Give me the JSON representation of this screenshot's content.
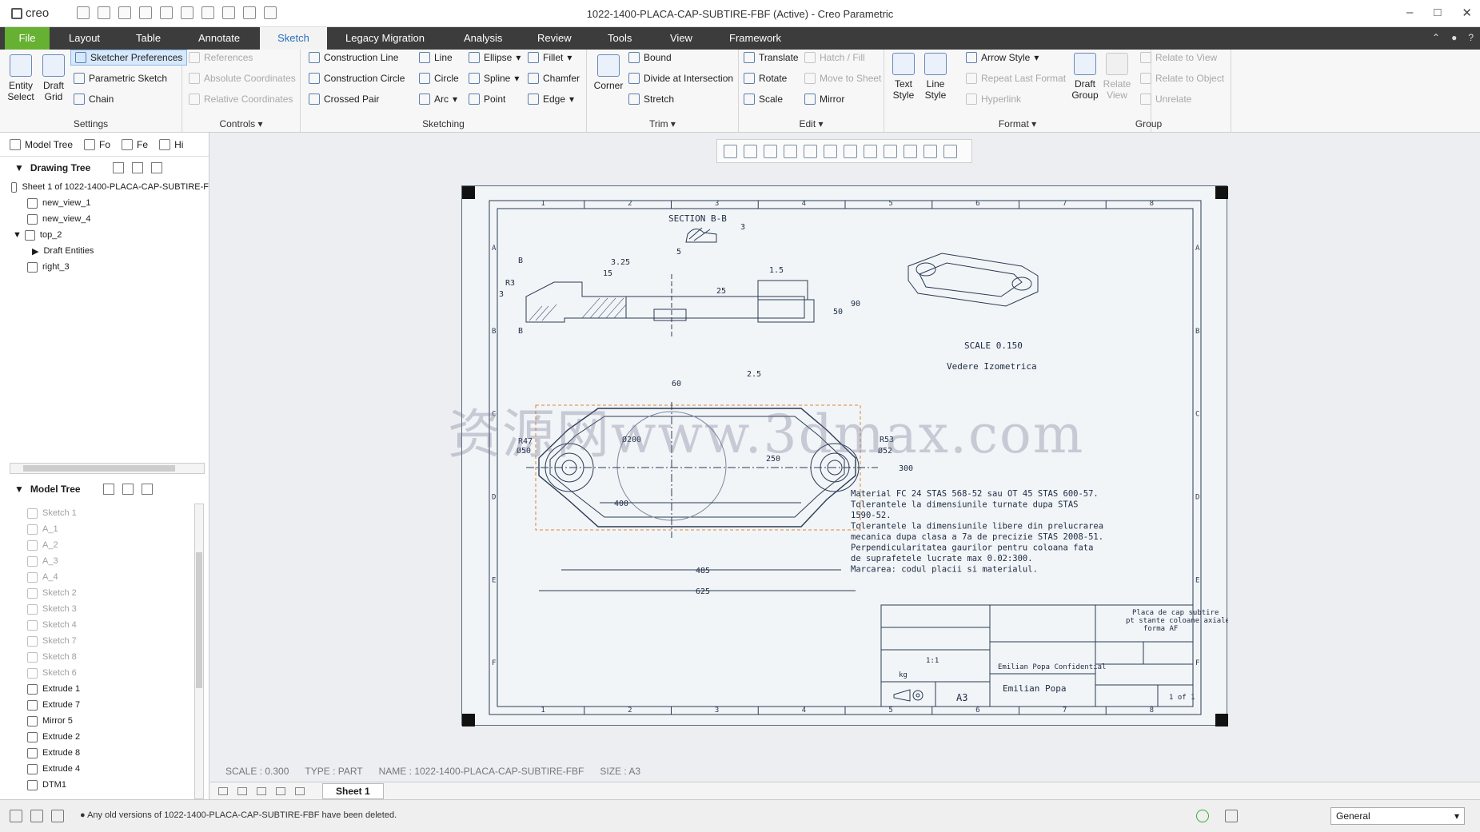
{
  "window": {
    "app_name": "creo",
    "title": "1022-1400-PLACA-CAP-SUBTIRE-FBF (Active) - Creo Parametric"
  },
  "menu": {
    "file": "File",
    "tabs": [
      "Layout",
      "Table",
      "Annotate",
      "Sketch",
      "Legacy Migration",
      "Analysis",
      "Review",
      "Tools",
      "View",
      "Framework"
    ]
  },
  "ribbon": {
    "settings": {
      "label": "Settings",
      "entity_select": "Entity Select",
      "draft_grid": "Draft Grid",
      "sketcher_prefs": "Sketcher Preferences",
      "parametric_sketch": "Parametric Sketch",
      "chain": "Chain"
    },
    "controls": {
      "label": "Controls",
      "references": "References",
      "absolute_coordinates": "Absolute Coordinates",
      "relative_coordinates": "Relative Coordinates"
    },
    "sketching": {
      "label": "Sketching",
      "construction_line": "Construction Line",
      "construction_circle": "Construction Circle",
      "crossed_pair": "Crossed Pair",
      "line": "Line",
      "circle": "Circle",
      "arc": "Arc",
      "ellipse": "Ellipse",
      "spline": "Spline",
      "point": "Point",
      "fillet": "Fillet",
      "chamfer": "Chamfer",
      "edge": "Edge"
    },
    "trim": {
      "label": "Trim",
      "corner": "Corner",
      "bound": "Bound",
      "divide": "Divide at Intersection",
      "stretch": "Stretch"
    },
    "edit": {
      "label": "Edit",
      "translate": "Translate",
      "rotate": "Rotate",
      "scale": "Scale",
      "hatch_fill": "Hatch / Fill",
      "move_to_sheet": "Move to Sheet",
      "mirror": "Mirror"
    },
    "format": {
      "label": "Format",
      "text_style": "Text Style",
      "line_style": "Line Style",
      "arrow_style": "Arrow Style",
      "repeat_last_format": "Repeat Last Format",
      "hyperlink": "Hyperlink"
    },
    "group": {
      "label": "Group",
      "draft_group": "Draft Group",
      "relate_view": "Relate View",
      "relate_to_view": "Relate to View",
      "relate_to_object": "Relate to Object",
      "unrelate": "Unrelate"
    }
  },
  "panel": {
    "tabs": [
      "Model Tree",
      "Fo",
      "Fe",
      "Hi"
    ],
    "drawing_tree": {
      "title": "Drawing Tree",
      "items": [
        "Sheet 1 of 1022-1400-PLACA-CAP-SUBTIRE-F",
        "new_view_1",
        "new_view_4",
        "top_2",
        "Draft Entities",
        "right_3"
      ]
    },
    "model_tree": {
      "title": "Model Tree",
      "items": [
        "Sketch 1",
        "A_1",
        "A_2",
        "A_3",
        "A_4",
        "Sketch 2",
        "Sketch 3",
        "Sketch 4",
        "Sketch 7",
        "Sketch 8",
        "Sketch 6",
        "Extrude 1",
        "Extrude 7",
        "Mirror 5",
        "Extrude 2",
        "Extrude 8",
        "Extrude 4",
        "DTM1"
      ]
    }
  },
  "drawing": {
    "section_title": "SECTION B-B",
    "scale_note": "SCALE 0.150",
    "iso_label": "Vedere Izometrica",
    "dims": [
      "3.25",
      "15",
      "R3",
      "3",
      "B",
      "B",
      "1.5",
      "25",
      "90",
      "50",
      "3",
      "5",
      "60",
      "2.5",
      "R47",
      "Ø50",
      "Ø200",
      "250",
      "R53",
      "Ø52",
      "300",
      "400",
      "485",
      "625"
    ],
    "notes": [
      "Material FC 24 STAS 568-52 sau OT 45 STAS 600-57.",
      "Tolerantele la dimensiunile turnate dupa STAS",
      "1590-52.",
      "Tolerantele la dimensiunile libere din prelucrarea",
      "mecanica dupa clasa a 7a de precizie STAS 2008-51.",
      "Perpendicularitatea gaurilor pentru coloana fata",
      "de suprafetele lucrate max 0.02:300.",
      "Marcarea: codul placii si materialul."
    ],
    "title_block": {
      "part_name": "Placa de cap subtire",
      "line2": "pt stante coloane axiale",
      "line3": "forma AF",
      "author": "Emilian Popa",
      "confidential": "Emilian Popa Confidential",
      "size": "A3",
      "sheet": "1 of 1",
      "scale": "1:1",
      "weight": "kg"
    },
    "col_labels": [
      "1",
      "2",
      "3",
      "4",
      "5",
      "6",
      "7",
      "8"
    ],
    "row_labels": [
      "A",
      "B",
      "C",
      "D",
      "E",
      "F"
    ],
    "watermark": "资源网www.3dmax.com"
  },
  "status_info": {
    "scale": "SCALE : 0.300",
    "type": "TYPE : PART",
    "name": "NAME : 1022-1400-PLACA-CAP-SUBTIRE-FBF",
    "size": "SIZE : A3"
  },
  "sheet_tab": "Sheet 1",
  "status": {
    "message": "Any old versions of 1022-1400-PLACA-CAP-SUBTIRE-FBF have been deleted.",
    "filter": "General"
  }
}
